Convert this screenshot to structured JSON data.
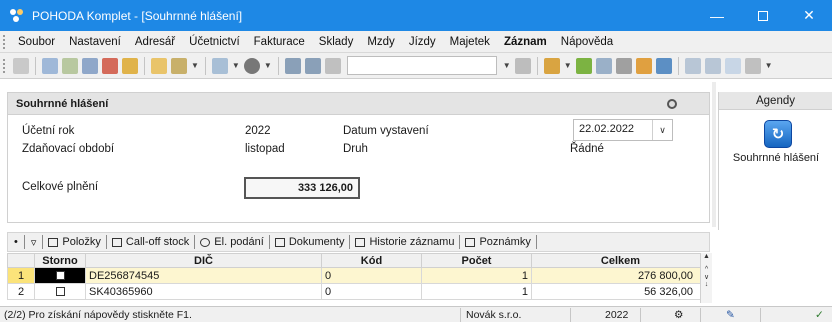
{
  "window": {
    "title": "POHODA Komplet - [Souhrnné hlášení]",
    "accent": "#1e88e5",
    "min_icon": "minimize-icon",
    "max_icon": "maximize-icon",
    "close_icon": "close-icon"
  },
  "menu": [
    "Soubor",
    "Nastavení",
    "Adresář",
    "Účetnictví",
    "Fakturace",
    "Sklady",
    "Mzdy",
    "Jízdy",
    "Majetek",
    "Záznam",
    "Nápověda"
  ],
  "form": {
    "header": "Souhrnné hlášení",
    "ucetni_rok_label": "Účetní rok",
    "ucetni_rok_value": "2022",
    "zdanovaci_label": "Zdaňovací období",
    "zdanovaci_value": "listopad",
    "datum_label": "Datum vystavení",
    "datum_value": "22.02.2022",
    "druh_label": "Druh",
    "druh_value": "Řádné",
    "celkove_label": "Celkové plnění",
    "celkove_value": "333 126,00"
  },
  "agendy": {
    "title": "Agendy",
    "item_label": "Souhrnné hlášení"
  },
  "tabs": [
    "Položky",
    "Call-off stock",
    "El. podání",
    "Dokumenty",
    "Historie záznamu",
    "Poznámky"
  ],
  "grid": {
    "columns": [
      "",
      "Storno",
      "DIČ",
      "Kód",
      "Počet",
      "Celkem"
    ],
    "rows": [
      {
        "n": "1",
        "dic": "DE256874545",
        "kod": "0",
        "pocet": "1",
        "celkem": "276 800,00"
      },
      {
        "n": "2",
        "dic": "SK40365960",
        "kod": "0",
        "pocet": "1",
        "celkem": "56 326,00"
      }
    ]
  },
  "status": {
    "hint": "(2/2) Pro získání nápovědy stiskněte F1.",
    "company": "Novák s.r.o.",
    "year": "2022"
  }
}
